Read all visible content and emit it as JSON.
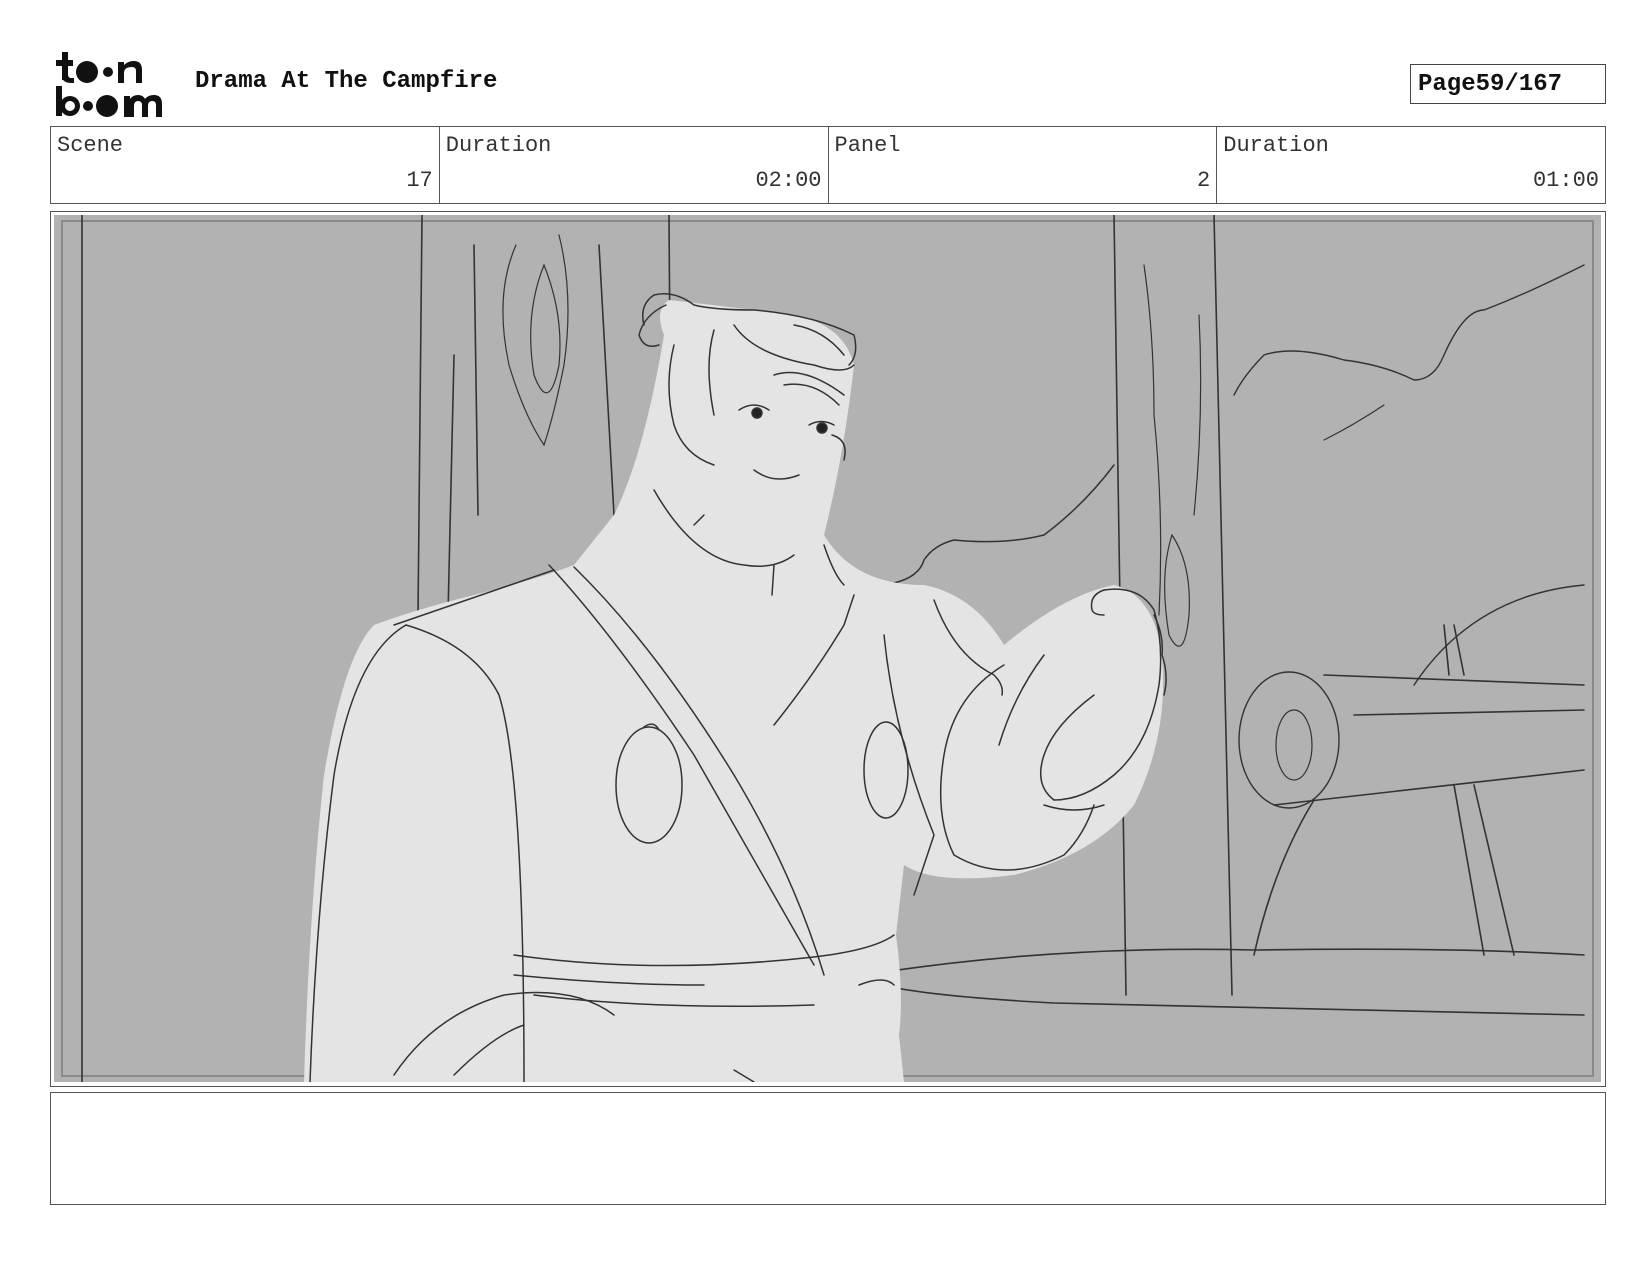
{
  "header": {
    "logo_text": "toon boom",
    "title": "Drama At The Campfire",
    "page_label": "Page",
    "page_number": "59/167"
  },
  "info": {
    "scene_label": "Scene",
    "scene_value": "17",
    "scene_duration_label": "Duration",
    "scene_duration_value": "02:00",
    "panel_label": "Panel",
    "panel_value": "2",
    "panel_duration_label": "Duration",
    "panel_duration_value": "01:00"
  },
  "panel": {
    "image_icon": "storyboard-sketch",
    "background_color": "#b2b2b2",
    "figure_color": "#e4e4e4"
  },
  "notes": {
    "text": ""
  }
}
